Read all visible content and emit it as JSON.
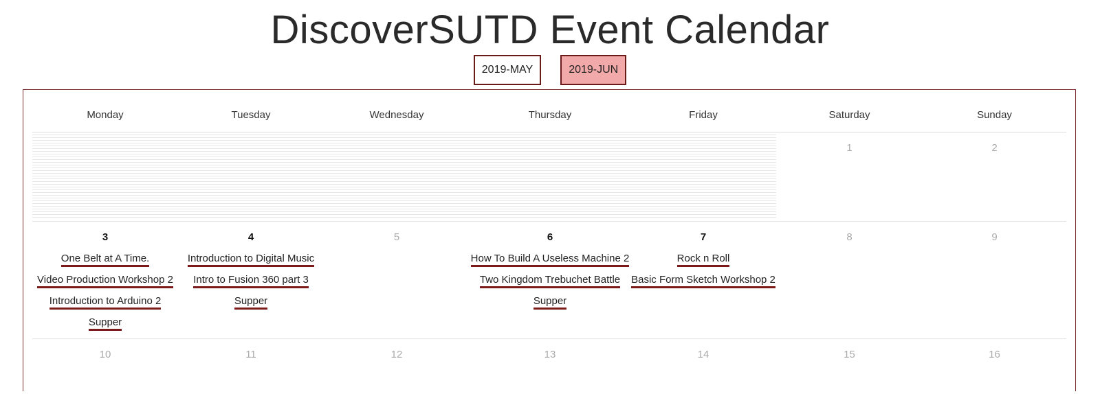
{
  "title": "DiscoverSUTD Event Calendar",
  "months": [
    {
      "label": "2019-MAY",
      "active": false
    },
    {
      "label": "2019-JUN",
      "active": true
    }
  ],
  "weekdays": [
    "Monday",
    "Tuesday",
    "Wednesday",
    "Thursday",
    "Friday",
    "Saturday",
    "Sunday"
  ],
  "weeks": [
    {
      "days": [
        {
          "num": "",
          "events": []
        },
        {
          "num": "",
          "events": []
        },
        {
          "num": "",
          "events": []
        },
        {
          "num": "",
          "events": []
        },
        {
          "num": "",
          "events": []
        },
        {
          "num": "1",
          "events": []
        },
        {
          "num": "2",
          "events": []
        }
      ]
    },
    {
      "days": [
        {
          "num": "3",
          "events": [
            "One Belt at A Time.",
            "Video Production Workshop 2",
            "Introduction to Arduino 2",
            "Supper"
          ]
        },
        {
          "num": "4",
          "events": [
            "Introduction to Digital Music",
            "Intro to Fusion 360 part 3",
            "Supper"
          ]
        },
        {
          "num": "5",
          "events": []
        },
        {
          "num": "6",
          "events": [
            "How To Build A Useless Machine 2",
            "Two Kingdom Trebuchet Battle",
            "Supper"
          ]
        },
        {
          "num": "7",
          "events": [
            "Rock n Roll",
            "Basic Form Sketch Workshop 2"
          ]
        },
        {
          "num": "8",
          "events": []
        },
        {
          "num": "9",
          "events": []
        }
      ]
    },
    {
      "days": [
        {
          "num": "10",
          "events": []
        },
        {
          "num": "11",
          "events": []
        },
        {
          "num": "12",
          "events": []
        },
        {
          "num": "13",
          "events": []
        },
        {
          "num": "14",
          "events": []
        },
        {
          "num": "15",
          "events": []
        },
        {
          "num": "16",
          "events": []
        }
      ]
    }
  ],
  "colors": {
    "accent": "#7a1a1a",
    "active_month_bg": "#f2a9a9",
    "muted_day": "#aaaaaa"
  }
}
